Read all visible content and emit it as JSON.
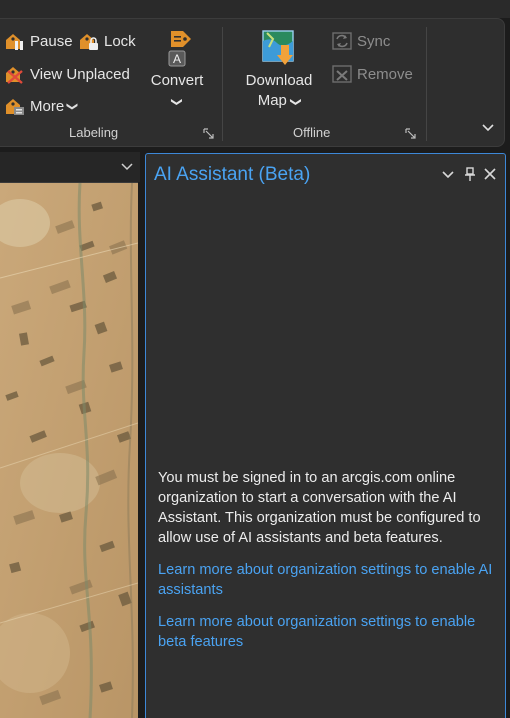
{
  "ribbon": {
    "labeling": {
      "pause_label": "Pause",
      "lock_label": "Lock",
      "view_unplaced_label": "View Unplaced",
      "more_label": "More",
      "convert_label": "Convert",
      "group_label": "Labeling"
    },
    "offline": {
      "download_map_label_line1": "Download",
      "download_map_label_line2": "Map",
      "sync_label": "Sync",
      "remove_label": "Remove",
      "group_label": "Offline"
    }
  },
  "pane": {
    "title": "AI Assistant (Beta)",
    "message": "You must be signed in to an arcgis.com online organization to start a conversation with the AI Assistant. This organization must be configured to allow use of AI assistants and beta features.",
    "link_ai_assistants": "Learn more about organization settings to enable AI assistants",
    "link_beta_features": "Learn more about organization settings to enable beta features"
  },
  "colors": {
    "accent": "#4aa3f2",
    "pane_border": "#3d88d8",
    "icon_orange": "#e0902a"
  },
  "icons": {
    "pause": "pause-labels-icon",
    "lock": "lock-labels-icon",
    "view_unplaced": "view-unplaced-icon",
    "more": "more-labeling-icon",
    "convert": "convert-labels-icon",
    "download_map": "download-map-icon",
    "sync": "sync-icon",
    "remove": "remove-offline-icon"
  }
}
